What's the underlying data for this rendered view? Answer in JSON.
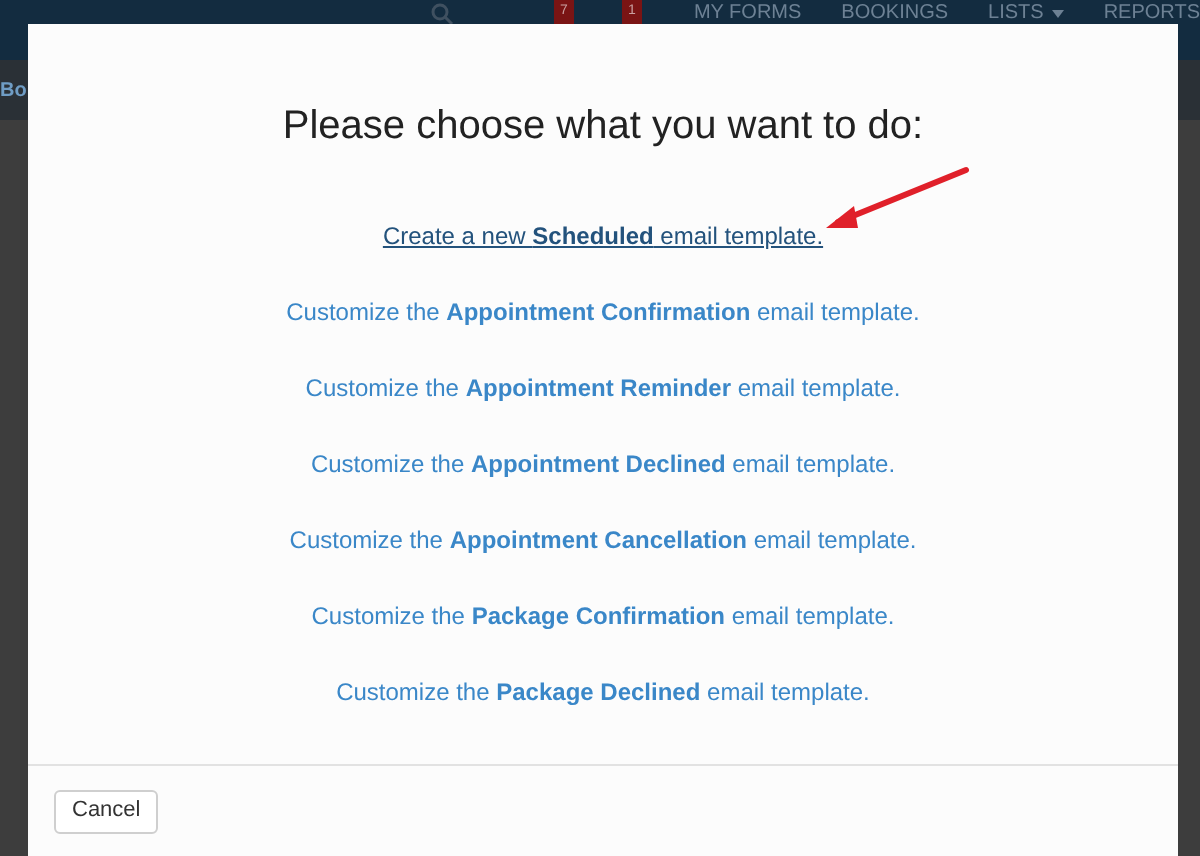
{
  "navbar": {
    "badges": [
      "7",
      "1"
    ],
    "items": [
      {
        "label": "MY FORMS",
        "dropdown": false
      },
      {
        "label": "BOOKINGS",
        "dropdown": false
      },
      {
        "label": "LISTS",
        "dropdown": true
      },
      {
        "label": "REPORTS",
        "dropdown": false
      }
    ]
  },
  "page": {
    "heading": "Bo"
  },
  "dialog": {
    "title": "Please choose what you want to do:",
    "options": [
      {
        "text": "Create a new **Scheduled** email template.",
        "hovered": true,
        "annotated": true
      },
      {
        "text": "Customize the **Appointment Confirmation** email template.",
        "hovered": false,
        "annotated": false
      },
      {
        "text": "Customize the **Appointment Reminder** email template.",
        "hovered": false,
        "annotated": false
      },
      {
        "text": "Customize the **Appointment Declined** email template.",
        "hovered": false,
        "annotated": false
      },
      {
        "text": "Customize the **Appointment Cancellation** email template.",
        "hovered": false,
        "annotated": false
      },
      {
        "text": "Customize the **Package Confirmation** email template.",
        "hovered": false,
        "annotated": false
      },
      {
        "text": "Customize the **Package Declined** email template.",
        "hovered": false,
        "annotated": false
      }
    ],
    "buttons": [
      "Cancel"
    ]
  }
}
